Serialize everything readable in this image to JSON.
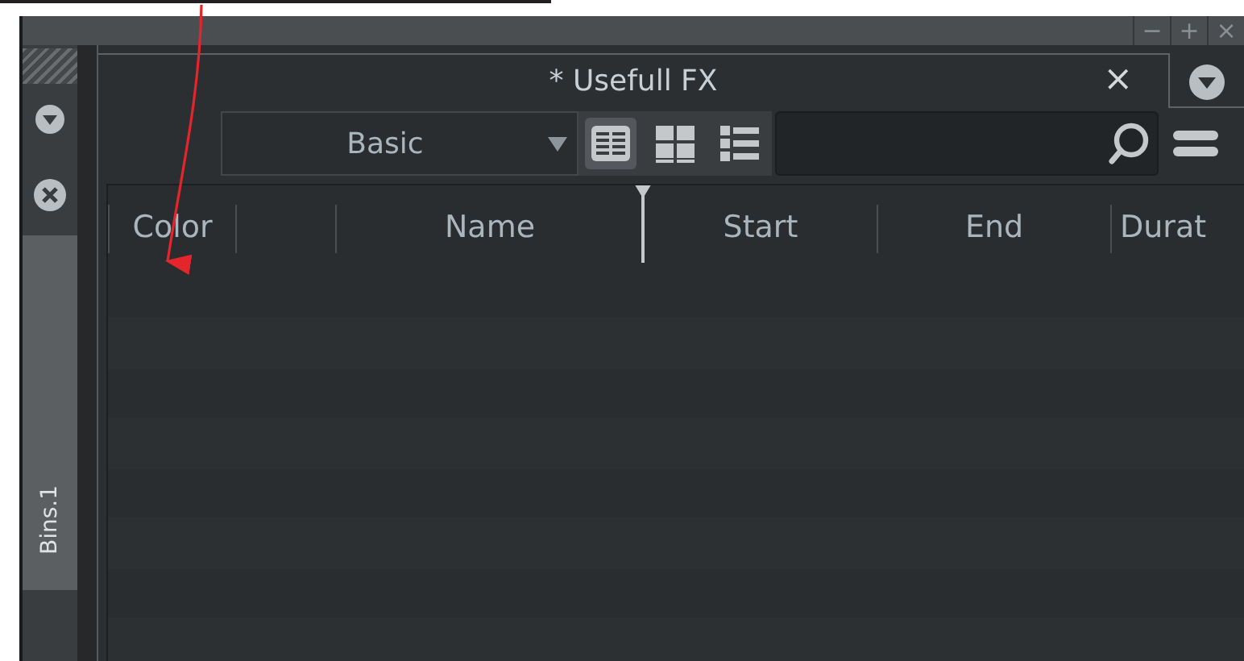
{
  "window": {
    "controls": [
      "−",
      "+",
      "×"
    ]
  },
  "side_dock": {
    "tab": "Bins.1"
  },
  "panel": {
    "title": "* Usefull FX",
    "close": "×"
  },
  "toolbar": {
    "preset": "Basic",
    "view_modes": [
      {
        "kind": "table",
        "selected": true
      },
      {
        "kind": "grid",
        "selected": false
      },
      {
        "kind": "list",
        "selected": false
      }
    ]
  },
  "table": {
    "columns": [
      {
        "kind": "text",
        "label": "Color"
      },
      {
        "kind": "empty"
      },
      {
        "kind": "text",
        "label": "Name"
      },
      {
        "kind": "text",
        "label": "Start"
      },
      {
        "kind": "text",
        "label": "End"
      },
      {
        "kind": "text",
        "label": "Durat"
      }
    ]
  }
}
